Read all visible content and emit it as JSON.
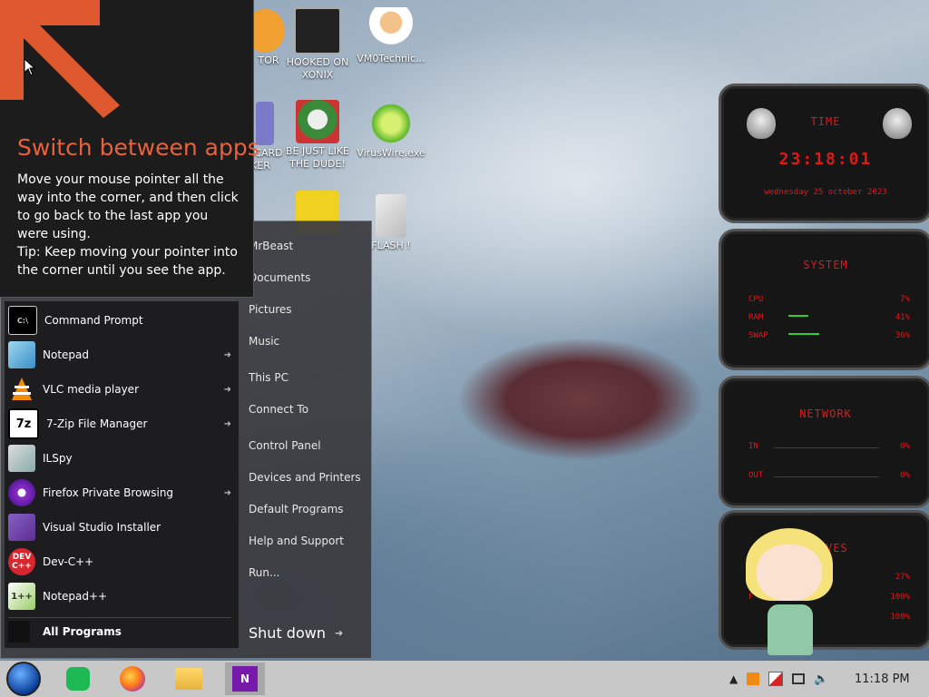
{
  "desktop_icons": [
    {
      "label": "TOR"
    },
    {
      "label": "HOOKED ON XONIX"
    },
    {
      "label": "VM0Technic..."
    },
    {
      "label": "CARD KER"
    },
    {
      "label": "BE JUST LIKE THE DUDE!"
    },
    {
      "label": "VirusWire.exe"
    },
    {
      "label": "FLASH !"
    }
  ],
  "tip": {
    "title": "Switch between apps",
    "body": "Move your mouse pointer all the way into the corner, and then click to go back to the last app you were using.",
    "tip": "Tip: Keep moving your pointer into the corner until you see the app."
  },
  "start_menu": {
    "programs": [
      {
        "label": "Command Prompt",
        "icon": "cmd-icon",
        "arrow": ""
      },
      {
        "label": "Notepad",
        "icon": "notepad-icon",
        "arrow": "➜"
      },
      {
        "label": "VLC media player",
        "icon": "vlc-icon",
        "arrow": "➜"
      },
      {
        "label": "7-Zip File Manager",
        "icon": "7zip-icon",
        "arrow": "➜"
      },
      {
        "label": "ILSpy",
        "icon": "ilspy-icon",
        "arrow": ""
      },
      {
        "label": "Firefox Private Browsing",
        "icon": "firefox-private-icon",
        "arrow": "➜"
      },
      {
        "label": "Visual Studio Installer",
        "icon": "vs-installer-icon",
        "arrow": ""
      },
      {
        "label": "Dev-C++",
        "icon": "devcpp-icon",
        "arrow": ""
      },
      {
        "label": "Notepad++",
        "icon": "notepadpp-icon",
        "arrow": ""
      }
    ],
    "all_programs": "All Programs",
    "right_items": [
      "MrBeast",
      "Documents",
      "Pictures",
      "Music",
      "This PC",
      "Connect To",
      "Control Panel",
      "Devices and Printers",
      "Default Programs",
      "Help and Support",
      "Run..."
    ],
    "shutdown": "Shut down",
    "shutdown_arrow": "➜"
  },
  "gadgets": {
    "time": {
      "title": "TIME",
      "clock": "23:18:01",
      "date": "wednesday 25 october 2023"
    },
    "system": {
      "title": "SYSTEM",
      "rows": [
        {
          "label": "CPU",
          "value": "7%"
        },
        {
          "label": "RAM",
          "value": "41%"
        },
        {
          "label": "SWAP",
          "value": "36%"
        }
      ]
    },
    "network": {
      "title": "NETWORK",
      "rows": [
        {
          "label": "IN",
          "value": "0%"
        },
        {
          "label": "OUT",
          "value": "0%"
        }
      ]
    },
    "drives": {
      "title": "DRIVES",
      "rows": [
        {
          "label": "",
          "value": "27%"
        },
        {
          "label": "F",
          "value": "100%"
        },
        {
          "label": "",
          "value": "100%"
        }
      ]
    }
  },
  "taskbar": {
    "clock": "11:18 PM"
  },
  "colors": {
    "accent": "#e7623c",
    "gadget_red": "#e01818",
    "taskbar": "#c8c8c8"
  }
}
